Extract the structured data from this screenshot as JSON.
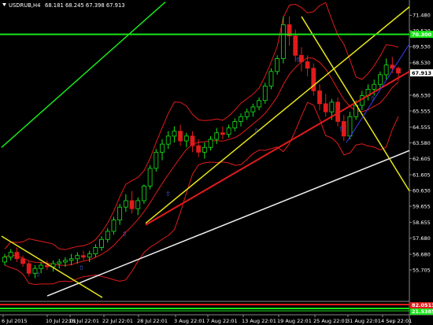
{
  "chart_header": {
    "symbol": "USDRUB,H4",
    "ohlc": "68.181 68.245 67.398 67.913"
  },
  "chart_data": {
    "type": "candlestick",
    "title": "",
    "ylim": [
      53.76,
      72.28
    ],
    "y_ticks": [
      "71.480",
      "70.520",
      "69.530",
      "68.530",
      "67.913",
      "66.530",
      "65.555",
      "64.555",
      "63.580",
      "62.605",
      "61.605",
      "60.630",
      "59.655",
      "58.655",
      "57.680",
      "56.680",
      "55.705"
    ],
    "x_ticks": [
      "6 Jul 2015",
      "10 Jul 22:01",
      "16 Jul 22:01",
      "22 Jul 22:01",
      "28 Jul 22:01",
      "3 Aug 22:01",
      "7 Aug 22:01",
      "13 Aug 22:01",
      "19 Aug 22:01",
      "25 Aug 22:01",
      "31 Aug 22:01",
      "4 Sep 22:01"
    ],
    "current_price": "67.913",
    "hline_price": "70.300",
    "price_series": [
      [
        56.2,
        56.7,
        56.0,
        56.5
      ],
      [
        56.5,
        57.0,
        56.3,
        56.8
      ],
      [
        56.8,
        57.1,
        56.2,
        56.4
      ],
      [
        56.4,
        56.6,
        55.9,
        56.1
      ],
      [
        56.1,
        56.3,
        55.3,
        55.5
      ],
      [
        55.5,
        56.0,
        55.2,
        55.8
      ],
      [
        55.8,
        56.2,
        55.5,
        56.0
      ],
      [
        56.0,
        56.3,
        55.7,
        55.9
      ],
      [
        55.9,
        56.3,
        55.6,
        56.1
      ],
      [
        56.1,
        56.4,
        55.8,
        56.2
      ],
      [
        56.2,
        56.5,
        55.9,
        56.3
      ],
      [
        56.3,
        56.7,
        56.0,
        56.4
      ],
      [
        56.4,
        56.8,
        56.1,
        56.6
      ],
      [
        56.6,
        56.9,
        56.3,
        56.5
      ],
      [
        56.5,
        56.9,
        56.2,
        56.7
      ],
      [
        56.7,
        57.3,
        56.5,
        57.1
      ],
      [
        57.1,
        57.8,
        56.9,
        57.6
      ],
      [
        57.6,
        58.3,
        57.4,
        58.1
      ],
      [
        58.1,
        59.0,
        57.9,
        58.8
      ],
      [
        58.8,
        59.8,
        58.5,
        59.6
      ],
      [
        59.6,
        60.4,
        59.3,
        60.0
      ],
      [
        60.0,
        60.6,
        59.2,
        59.5
      ],
      [
        59.5,
        60.2,
        59.1,
        60.0
      ],
      [
        60.0,
        61.0,
        59.8,
        60.9
      ],
      [
        60.9,
        62.2,
        60.7,
        62.0
      ],
      [
        62.0,
        63.2,
        61.8,
        63.0
      ],
      [
        63.0,
        63.8,
        62.5,
        63.5
      ],
      [
        63.5,
        64.3,
        63.2,
        64.0
      ],
      [
        64.0,
        64.6,
        63.6,
        64.3
      ],
      [
        64.3,
        64.7,
        63.4,
        63.7
      ],
      [
        63.7,
        64.2,
        63.3,
        64.0
      ],
      [
        64.0,
        64.3,
        63.0,
        63.4
      ],
      [
        63.4,
        63.8,
        62.7,
        63.0
      ],
      [
        63.0,
        63.6,
        62.6,
        63.3
      ],
      [
        63.3,
        64.0,
        63.1,
        63.8
      ],
      [
        63.8,
        64.5,
        63.5,
        64.2
      ],
      [
        64.2,
        64.6,
        63.8,
        64.1
      ],
      [
        64.1,
        64.7,
        63.9,
        64.5
      ],
      [
        64.5,
        65.1,
        64.3,
        64.9
      ],
      [
        64.9,
        65.4,
        64.6,
        65.2
      ],
      [
        65.2,
        65.7,
        65.0,
        65.5
      ],
      [
        65.5,
        66.0,
        65.2,
        65.8
      ],
      [
        65.8,
        66.4,
        65.6,
        66.2
      ],
      [
        66.2,
        67.3,
        66.0,
        67.1
      ],
      [
        67.1,
        68.2,
        66.9,
        68.0
      ],
      [
        68.0,
        69.0,
        67.8,
        68.8
      ],
      [
        68.8,
        71.4,
        68.5,
        70.9
      ],
      [
        70.9,
        71.4,
        69.6,
        70.2
      ],
      [
        70.2,
        70.6,
        68.6,
        69.0
      ],
      [
        69.0,
        69.5,
        68.0,
        68.6
      ],
      [
        68.6,
        69.0,
        67.7,
        68.2
      ],
      [
        68.2,
        68.5,
        66.5,
        66.8
      ],
      [
        66.8,
        67.2,
        65.6,
        66.0
      ],
      [
        66.0,
        66.6,
        65.2,
        65.5
      ],
      [
        65.5,
        66.3,
        65.0,
        66.1
      ],
      [
        66.1,
        66.4,
        64.6,
        64.9
      ],
      [
        64.9,
        65.3,
        63.7,
        64.0
      ],
      [
        64.0,
        65.5,
        63.8,
        65.2
      ],
      [
        65.2,
        66.2,
        65.0,
        65.9
      ],
      [
        65.9,
        66.8,
        65.6,
        66.5
      ],
      [
        66.5,
        67.2,
        66.2,
        66.9
      ],
      [
        66.9,
        67.5,
        66.5,
        67.2
      ],
      [
        67.2,
        68.0,
        67.0,
        67.8
      ],
      [
        67.8,
        68.8,
        67.5,
        68.4
      ],
      [
        68.4,
        68.9,
        67.9,
        68.2
      ],
      [
        68.2,
        68.3,
        67.4,
        67.9
      ]
    ]
  },
  "bottom_tags": {
    "red_value": "82.0513",
    "green_value": "21.5385"
  }
}
